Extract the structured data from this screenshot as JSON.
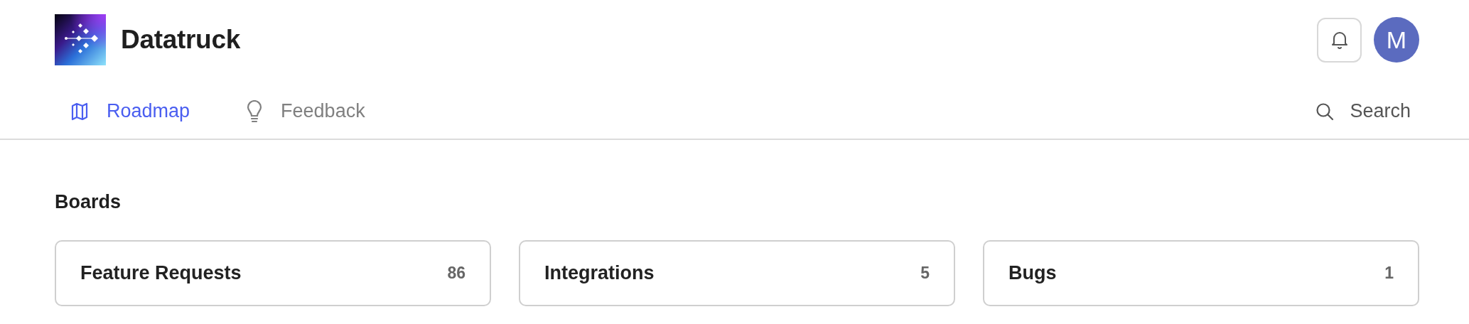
{
  "header": {
    "title": "Datatruck",
    "avatar": "M"
  },
  "tabs": [
    {
      "label": "Roadmap",
      "selected": true
    },
    {
      "label": "Feedback",
      "selected": false
    }
  ],
  "search": {
    "label": "Search"
  },
  "boards": {
    "heading": "Boards",
    "items": [
      {
        "name": "Feature Requests",
        "count": "86"
      },
      {
        "name": "Integrations",
        "count": "5"
      },
      {
        "name": "Bugs",
        "count": "1"
      }
    ]
  }
}
